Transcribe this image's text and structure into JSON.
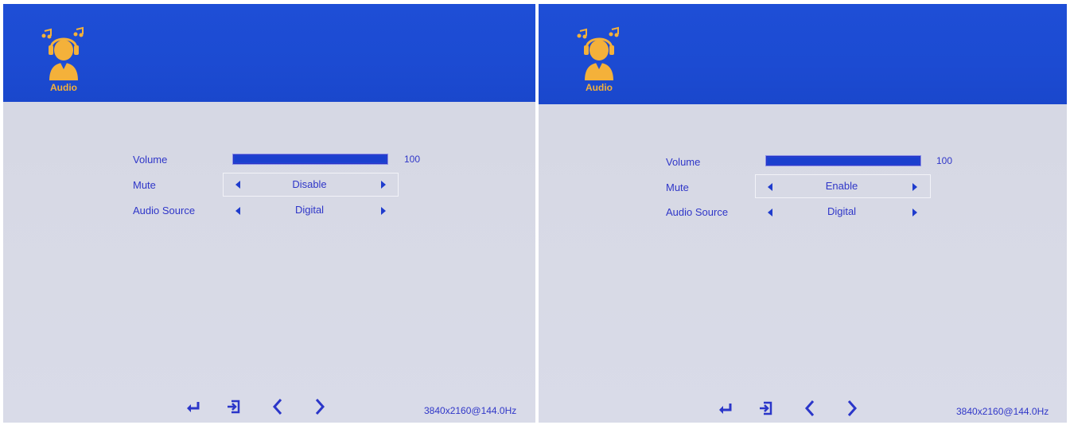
{
  "panels": [
    {
      "header": {
        "title": "Audio",
        "icon": "audio-headset-icon"
      },
      "menu": {
        "volume": {
          "label": "Volume",
          "value": "100",
          "level": 1.0
        },
        "mute": {
          "label": "Mute",
          "value": "Disable",
          "selected": true
        },
        "audio_source": {
          "label": "Audio Source",
          "value": "Digital"
        }
      },
      "footer": {
        "icons": [
          "enter-icon",
          "exit-icon",
          "chevron-left-icon",
          "chevron-right-icon"
        ],
        "resolution": "3840x2160@144.0Hz"
      }
    },
    {
      "header": {
        "title": "Audio",
        "icon": "audio-headset-icon"
      },
      "menu": {
        "volume": {
          "label": "Volume",
          "value": "100",
          "level": 1.0
        },
        "mute": {
          "label": "Mute",
          "value": "Enable",
          "selected": true
        },
        "audio_source": {
          "label": "Audio Source",
          "value": "Digital"
        }
      },
      "footer": {
        "icons": [
          "enter-icon",
          "exit-icon",
          "chevron-left-icon",
          "chevron-right-icon"
        ],
        "resolution": "3840x2160@144.0Hz"
      }
    }
  ],
  "colors": {
    "header_blue": "#1e4ed6",
    "panel_gray": "#d7d9e5",
    "accent_orange": "#f4b13a",
    "text_blue": "#2f36c8"
  }
}
